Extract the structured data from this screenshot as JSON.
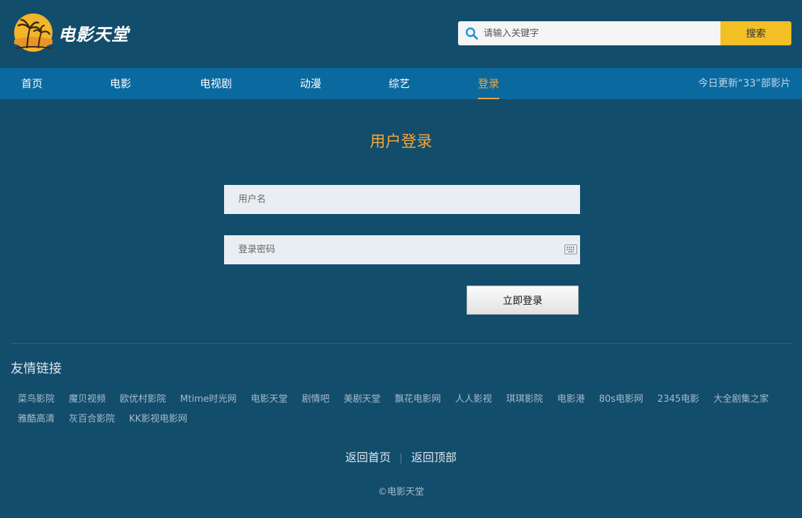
{
  "header": {
    "logo_text": "电影天堂",
    "search": {
      "placeholder": "请输入关键字",
      "button_label": "搜索"
    }
  },
  "nav": {
    "items": [
      {
        "label": "首页"
      },
      {
        "label": "电影"
      },
      {
        "label": "电视剧"
      },
      {
        "label": "动漫"
      },
      {
        "label": "综艺"
      },
      {
        "label": "登录"
      }
    ],
    "active": "登录",
    "update_text": "今日更新“33”部影片"
  },
  "login": {
    "title": "用户登录",
    "username_placeholder": "用户名",
    "password_placeholder": "登录密码",
    "submit_label": "立即登录"
  },
  "friend_links": {
    "title": "友情链接",
    "items": [
      "菜鸟影院",
      "魔贝视频",
      "欧优村影院",
      "Mtime时光网",
      "电影天堂",
      "剧情吧",
      "美剧天堂",
      "飘花电影网",
      "人人影视",
      "琪琪影院",
      "电影港",
      "80s电影网",
      "2345电影",
      "大全剧集之家",
      "雅酷高清",
      "灰百合影院",
      "KK影视电影网"
    ]
  },
  "footer": {
    "home_link": "返回首页",
    "top_link": "返回顶部",
    "copyright": "©电影天堂"
  },
  "colors": {
    "background": "#134d6c",
    "nav": "#0a6aa0",
    "accent": "#f3a53a",
    "search_button": "#f2bf25"
  },
  "icons": {
    "logo": "palm-tree-sunset-icon",
    "search": "search-icon",
    "keyboard": "keyboard-icon"
  }
}
